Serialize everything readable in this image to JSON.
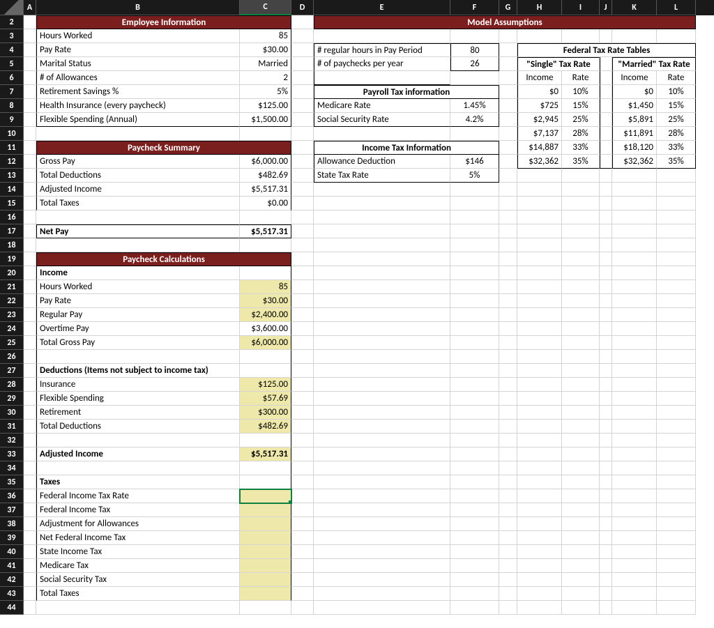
{
  "columns": [
    "A",
    "B",
    "C",
    "D",
    "E",
    "F",
    "G",
    "H",
    "I",
    "J",
    "K",
    "L"
  ],
  "activeCol": "C",
  "selectedCell": {
    "row": 36,
    "col": "C"
  },
  "employeeInfo": {
    "header": "Employee Information",
    "rows": [
      {
        "label": "Hours Worked",
        "value": "85"
      },
      {
        "label": "Pay Rate",
        "value": "$30.00"
      },
      {
        "label": "Marital Status",
        "value": "Married"
      },
      {
        "label": "# of Allowances",
        "value": "2"
      },
      {
        "label": "Retirement Savings %",
        "value": "5%"
      },
      {
        "label": "Health Insurance (every paycheck)",
        "value": "$125.00"
      },
      {
        "label": "Flexible Spending (Annual)",
        "value": "$1,500.00"
      }
    ]
  },
  "paycheckSummary": {
    "header": "Paycheck Summary",
    "rows": [
      {
        "label": "Gross Pay",
        "value": "$6,000.00"
      },
      {
        "label": "Total Deductions",
        "value": "$482.69"
      },
      {
        "label": "Adjusted Income",
        "value": "$5,517.31"
      },
      {
        "label": "Total Taxes",
        "value": "$0.00"
      }
    ],
    "netLabel": "Net Pay",
    "netValue": "$5,517.31"
  },
  "paycheckCalc": {
    "header": "Paycheck Calculations",
    "income": {
      "header": "Income",
      "rows": [
        {
          "label": "Hours Worked",
          "value": "85",
          "yellow": true
        },
        {
          "label": "Pay Rate",
          "value": "$30.00",
          "yellow": true
        },
        {
          "label": "Regular Pay",
          "value": "$2,400.00",
          "yellow": true
        },
        {
          "label": "Overtime Pay",
          "value": "$3,600.00",
          "yellow": false
        },
        {
          "label": "Total Gross Pay",
          "value": "$6,000.00",
          "yellow": true
        }
      ]
    },
    "deductions": {
      "header": "Deductions (Items not subject to income tax)",
      "rows": [
        {
          "label": "Insurance",
          "value": "$125.00"
        },
        {
          "label": "Flexible Spending",
          "value": "$57.69"
        },
        {
          "label": "Retirement",
          "value": "$300.00"
        },
        {
          "label": "Total Deductions",
          "value": "$482.69"
        }
      ]
    },
    "adjusted": {
      "label": "Adjusted Income",
      "value": "$5,517.31"
    },
    "taxes": {
      "header": "Taxes",
      "rows": [
        "Federal Income Tax Rate",
        "Federal Income Tax",
        "Adjustment for Allowances",
        "Net Federal Income Tax",
        "State Income Tax",
        "Medicare Tax",
        "Social Security Tax",
        "Total Taxes"
      ]
    }
  },
  "modelAssumptions": {
    "header": "Model Assumptions",
    "regHoursLabel": "# regular hours in Pay Period",
    "regHours": "80",
    "paychecksLabel": "# of paychecks per year",
    "paychecks": "26",
    "payrollHeader": "Payroll Tax information",
    "medicareLabel": "Medicare Rate",
    "medicareRate": "1.45%",
    "ssLabel": "Social Security Rate",
    "ssRate": "4.2%",
    "incomeTaxHeader": "Income Tax Information",
    "allowanceLabel": "Allowance Deduction",
    "allowance": "$146",
    "stateLabel": "State Tax Rate",
    "stateRate": "5%",
    "fedHeader": "Federal Tax Rate Tables",
    "singleHeader": "\"Single\" Tax Rate",
    "marriedHeader": "\"Married\" Tax Rate",
    "incomeLbl": "Income",
    "rateLbl": "Rate",
    "table": [
      {
        "sInc": "$0",
        "sRate": "10%",
        "mInc": "$0",
        "mRate": "10%"
      },
      {
        "sInc": "$725",
        "sRate": "15%",
        "mInc": "$1,450",
        "mRate": "15%"
      },
      {
        "sInc": "$2,945",
        "sRate": "25%",
        "mInc": "$5,891",
        "mRate": "25%"
      },
      {
        "sInc": "$7,137",
        "sRate": "28%",
        "mInc": "$11,891",
        "mRate": "28%"
      },
      {
        "sInc": "$14,887",
        "sRate": "33%",
        "mInc": "$18,120",
        "mRate": "33%"
      },
      {
        "sInc": "$32,362",
        "sRate": "35%",
        "mInc": "$32,362",
        "mRate": "35%"
      }
    ]
  }
}
